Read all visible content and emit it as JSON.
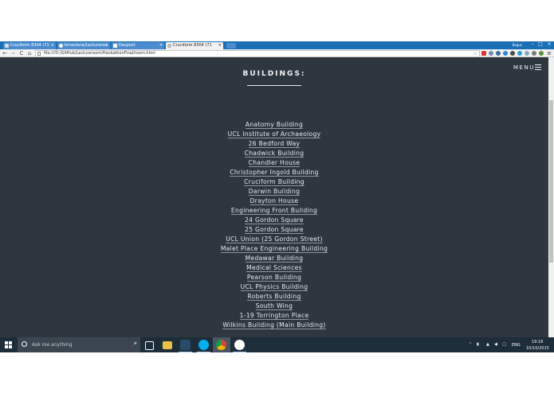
{
  "browser": {
    "tabs": [
      {
        "label": "Cruciform 8304 (71",
        "active": false
      },
      {
        "label": "bmaulana/Lectureroo",
        "active": false
      },
      {
        "label": "Devpost",
        "active": false
      },
      {
        "label": "Cruciform 8304 (71",
        "active": true
      }
    ],
    "tab_close": "×",
    "window_user": "Bagus",
    "address": "file:///D:/GitHub/Lectureroom/HackathonFinal/room.html",
    "nav": {
      "back": "←",
      "forward": "→",
      "reload": "C",
      "home": "⌂"
    },
    "star": "☆",
    "menu_glyph": "≡",
    "window_controls": {
      "minimize": "–",
      "maximize": "□",
      "close": "×"
    }
  },
  "page": {
    "heading": "BUILDINGS:",
    "menu_label": "MENU",
    "buildings": [
      "Anatomy Building",
      "UCL Institute of Archaeology",
      "26 Bedford Way",
      "Chadwick Building",
      "Chandler House",
      "Christopher Ingold Building",
      "Cruciform Building",
      "Darwin Building",
      "Drayton House",
      "Engineering Front Building",
      "24 Gordon Square",
      "25 Gordon Square",
      "UCL Union (25 Gordon Street)",
      "Malet Place Engineering Building",
      "Medawar Building",
      "Medical Sciences",
      "Pearson Building",
      "UCL Physics Building",
      "Roberts Building",
      "South Wing",
      "1-19 Torrington Place",
      "Wilkins Building (Main Building)"
    ]
  },
  "taskbar": {
    "search_placeholder": "Ask me anything",
    "lang": "ENG",
    "time": "19:16",
    "date": "10/10/2015"
  },
  "colors": {
    "page_bg": "#2e3640",
    "tab_strip": "#1b6fb5",
    "taskbar": "#1d2d3a"
  }
}
